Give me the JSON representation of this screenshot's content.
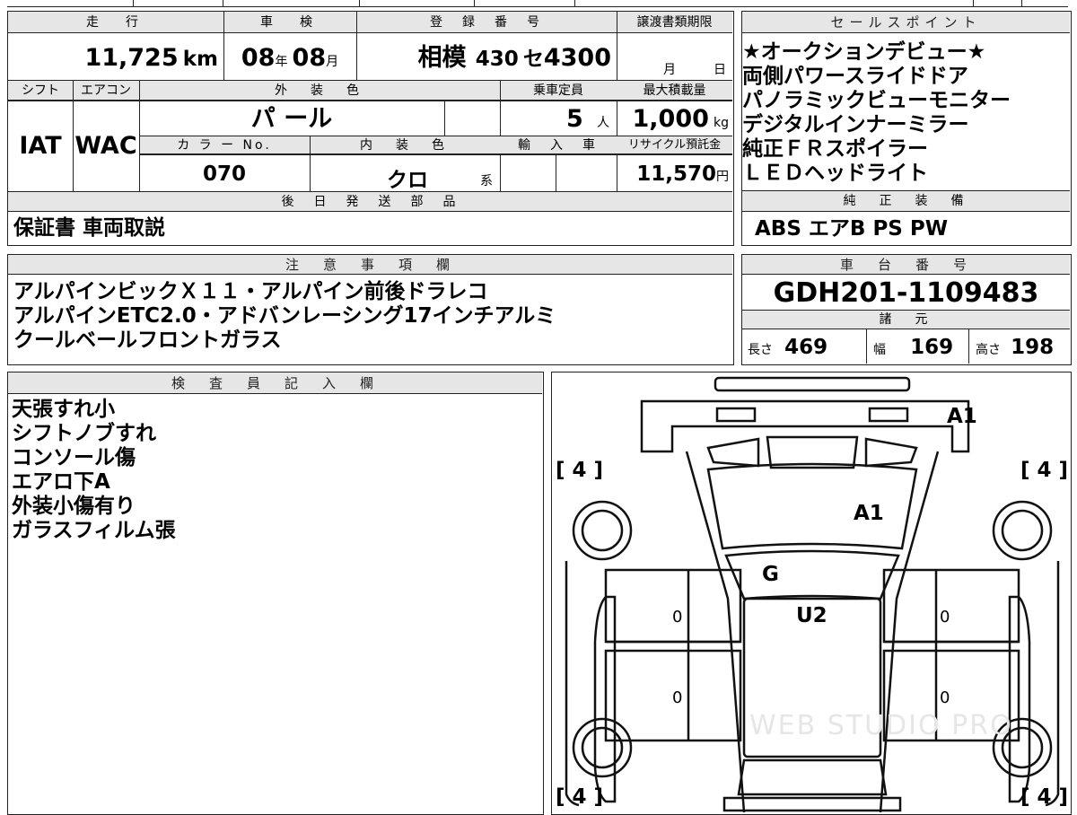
{
  "headers": {
    "mileage": "走　行",
    "inspection": "車　検",
    "registration": "登　録　番　号",
    "transfer_deadline": "譲渡書類期限",
    "shift": "シフト",
    "aircon": "エアコン",
    "exterior_color": "外　装　色",
    "capacity": "乗車定員",
    "max_load": "最大積載量",
    "color_no": "カ ラ ー No.",
    "interior_color": "内　装　色",
    "import": "輸　入　車",
    "recycle": "リサイクル預託金",
    "later_parts": "後　日　発　送　部　品",
    "sales_points": "セールスポイント",
    "factory_equipment": "純　正　装　備",
    "notes": "注　意　事　項　欄",
    "chassis_number": "車　台　番　号",
    "specs": "諸　元",
    "inspector": "検　査　員　記　入　欄"
  },
  "vehicle": {
    "mileage_value": "11,725",
    "mileage_unit": "km",
    "inspection_year": "08",
    "year_label": "年",
    "inspection_month": "08",
    "month_label": "月",
    "plate_region": "相模",
    "plate_class": "430",
    "plate_kana": "セ",
    "plate_number": "4300",
    "deadline_month_label": "月",
    "deadline_day_label": "日",
    "shift_value": "IAT",
    "aircon_value": "WAC",
    "exterior_color_value": "パ ール",
    "capacity_value": "5",
    "capacity_unit": "人",
    "max_load_value": "1,000",
    "max_load_unit": "kg",
    "color_no_value": "070",
    "interior_color_value": "クロ",
    "interior_color_suffix": "系",
    "recycle_value": "11,570",
    "recycle_unit": "円"
  },
  "later_parts_value": "保証書 車両取説",
  "sales_points": [
    "★オークションデビュー★",
    "両側パワースライドドア",
    "パノラミックビューモニター",
    "デジタルインナーミラー",
    "純正ＦＲスポイラー",
    "ＬＥＤヘッドライト"
  ],
  "factory_equipment_value": "ABS エアB PS PW",
  "notes": [
    "アルパインビックＸ１１・アルパイン前後ドラレコ",
    "アルパインETC2.0・アドバンレーシング17インチアルミ",
    "クールベールフロントガラス"
  ],
  "chassis_number_value": "GDH201-1109483",
  "specs": {
    "length_label": "長さ",
    "length_value": "469",
    "width_label": "幅",
    "width_value": "169",
    "height_label": "高さ",
    "height_value": "198"
  },
  "inspector_notes": [
    "天張すれ小",
    "シフトノブすれ",
    "コンソール傷",
    "エアロ下A",
    "外装小傷有り",
    "ガラスフィルム張"
  ],
  "diagram": {
    "tire_label": "[ 4 ]",
    "marks": {
      "front_bumper": "A1",
      "hood": "A1",
      "windshield": "G",
      "roof": "U2",
      "left_front_door": "0",
      "left_rear_door": "0",
      "right_front_door": "0",
      "right_rear_door": "0"
    },
    "watermark": "WEB STUDIO PRO"
  }
}
